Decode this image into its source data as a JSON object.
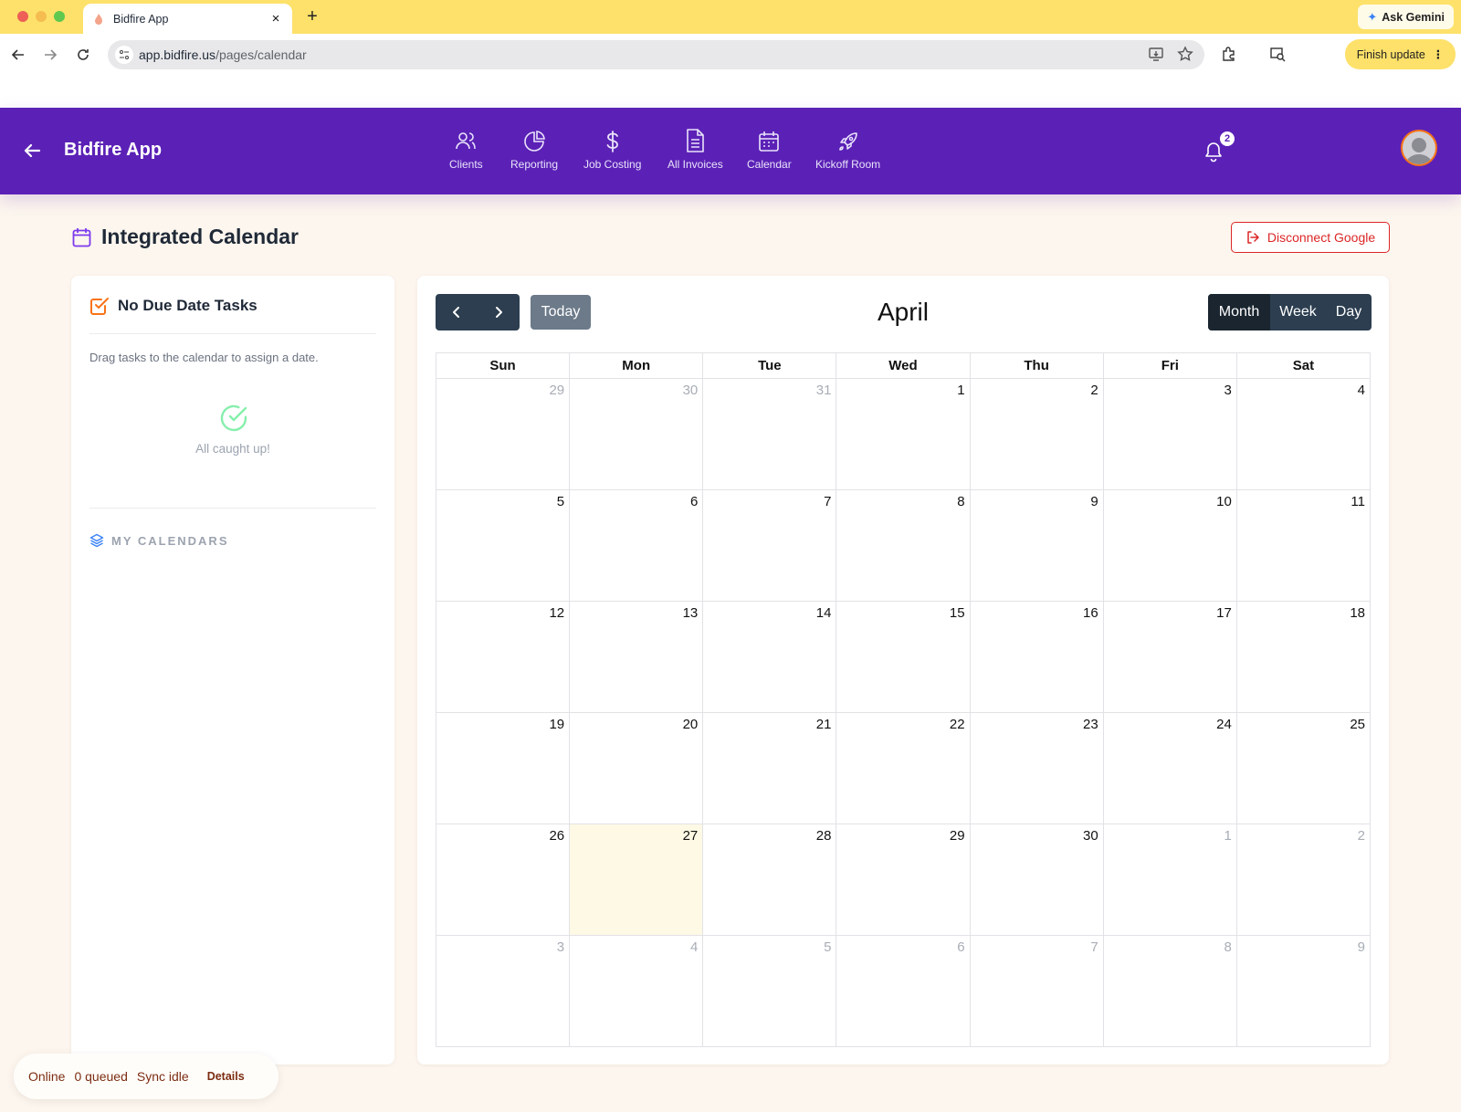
{
  "browser": {
    "tab_title": "Bidfire App",
    "url_domain": "app.bidfire.us",
    "url_path": "/pages/calendar",
    "ask_gemini": "Ask Gemini",
    "finish_update": "Finish update"
  },
  "header": {
    "app_title": "Bidfire App",
    "nav": [
      {
        "label": "Clients",
        "icon": "users-icon"
      },
      {
        "label": "Reporting",
        "icon": "pie-chart-icon"
      },
      {
        "label": "Job Costing",
        "icon": "dollar-icon"
      },
      {
        "label": "All Invoices",
        "icon": "document-icon"
      },
      {
        "label": "Calendar",
        "icon": "calendar-icon"
      },
      {
        "label": "Kickoff Room",
        "icon": "rocket-icon"
      }
    ],
    "notification_count": "2"
  },
  "page": {
    "title": "Integrated Calendar",
    "disconnect_label": "Disconnect Google"
  },
  "sidebar": {
    "title": "No Due Date Tasks",
    "hint": "Drag tasks to the calendar to assign a date.",
    "empty_text": "All caught up!",
    "my_calendars": "MY CALENDARS"
  },
  "calendar": {
    "month": "April",
    "today_label": "Today",
    "views": [
      "Month",
      "Week",
      "Day"
    ],
    "active_view": "Month",
    "weekdays": [
      "Sun",
      "Mon",
      "Tue",
      "Wed",
      "Thu",
      "Fri",
      "Sat"
    ],
    "weeks": [
      [
        {
          "d": "29",
          "o": true
        },
        {
          "d": "30",
          "o": true
        },
        {
          "d": "31",
          "o": true
        },
        {
          "d": "1"
        },
        {
          "d": "2"
        },
        {
          "d": "3"
        },
        {
          "d": "4"
        }
      ],
      [
        {
          "d": "5"
        },
        {
          "d": "6"
        },
        {
          "d": "7"
        },
        {
          "d": "8"
        },
        {
          "d": "9"
        },
        {
          "d": "10"
        },
        {
          "d": "11"
        }
      ],
      [
        {
          "d": "12"
        },
        {
          "d": "13"
        },
        {
          "d": "14"
        },
        {
          "d": "15"
        },
        {
          "d": "16"
        },
        {
          "d": "17"
        },
        {
          "d": "18"
        }
      ],
      [
        {
          "d": "19"
        },
        {
          "d": "20"
        },
        {
          "d": "21"
        },
        {
          "d": "22"
        },
        {
          "d": "23"
        },
        {
          "d": "24"
        },
        {
          "d": "25"
        }
      ],
      [
        {
          "d": "26"
        },
        {
          "d": "27",
          "t": true
        },
        {
          "d": "28"
        },
        {
          "d": "29"
        },
        {
          "d": "30"
        },
        {
          "d": "1",
          "o": true
        },
        {
          "d": "2",
          "o": true
        }
      ],
      [
        {
          "d": "3",
          "o": true
        },
        {
          "d": "4",
          "o": true
        },
        {
          "d": "5",
          "o": true
        },
        {
          "d": "6",
          "o": true
        },
        {
          "d": "7",
          "o": true
        },
        {
          "d": "8",
          "o": true
        },
        {
          "d": "9",
          "o": true
        }
      ]
    ]
  },
  "status": {
    "online": "Online",
    "queued": "0 queued",
    "sync": "Sync idle",
    "details": "Details"
  },
  "colors": {
    "brand_purple": "#5b21b6",
    "accent_orange": "#f97316",
    "danger_red": "#dc2626",
    "success_green": "#86efac",
    "today_highlight": "#fef9e5"
  }
}
